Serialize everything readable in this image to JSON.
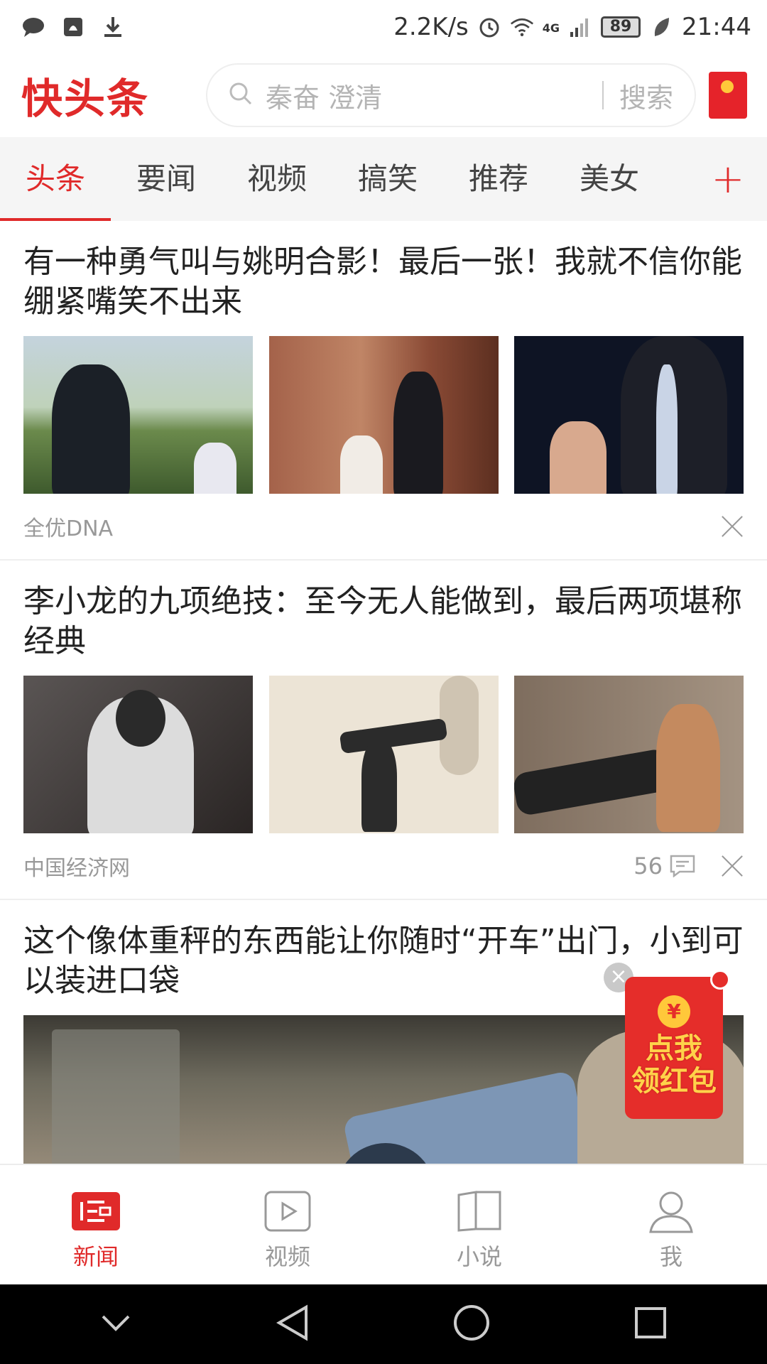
{
  "status_bar": {
    "net_speed": "2.2K/s",
    "network": "4G",
    "battery": "89",
    "time": "21:44"
  },
  "header": {
    "logo": "快头条",
    "search_placeholder": "秦奋 澄清",
    "search_button": "搜索"
  },
  "tabs": [
    {
      "label": "头条",
      "active": true
    },
    {
      "label": "要闻"
    },
    {
      "label": "视频"
    },
    {
      "label": "搞笑"
    },
    {
      "label": "推荐"
    },
    {
      "label": "美女"
    }
  ],
  "tab_add": "+",
  "articles": [
    {
      "title": "有一种勇气叫与姚明合影！最后一张！我就不信你能绷紧嘴笑不出来",
      "source": "全优DNA",
      "comments": ""
    },
    {
      "title": "李小龙的九项绝技：至今无人能做到，最后两项堪称经典",
      "source": "中国经济网",
      "comments": "56"
    },
    {
      "title": "这个像体重秤的东西能让你随时“开车”出门，小到可以装进口袋"
    }
  ],
  "floating_packet": {
    "coin": "¥",
    "line1": "点我",
    "line2": "领红包"
  },
  "bottom_nav": [
    {
      "label": "新闻",
      "icon": "news-icon",
      "active": true
    },
    {
      "label": "视频",
      "icon": "video-icon"
    },
    {
      "label": "小说",
      "icon": "book-icon"
    },
    {
      "label": "我",
      "icon": "profile-icon"
    }
  ],
  "colors": {
    "accent": "#e02a2a",
    "muted": "#999999"
  }
}
